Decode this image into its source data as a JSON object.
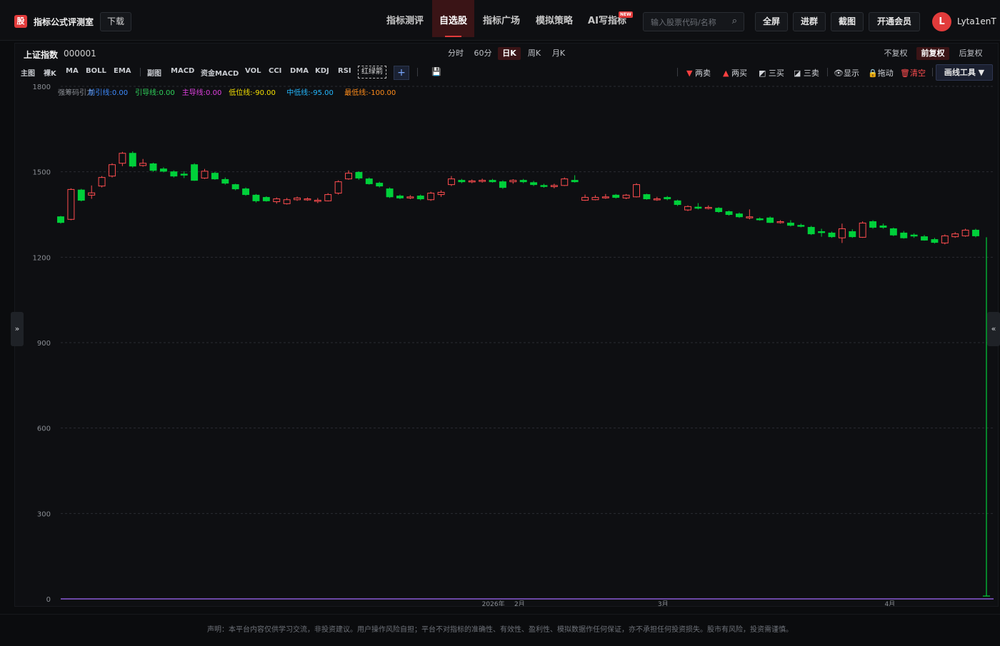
{
  "app": {
    "logo_text": "股",
    "brand": "指标公式评测室",
    "download": "下载",
    "nav": [
      "指标测评",
      "自选股",
      "指标广场",
      "模拟策略",
      "AI写指标"
    ],
    "nav_active": "自选股",
    "new_badge": "NEW",
    "search_placeholder": "输入股票代码/名称",
    "buttons": [
      "全屏",
      "进群",
      "截图",
      "开通会员"
    ],
    "avatar_initial": "L",
    "username": "Lyta1enT"
  },
  "instrument": {
    "name": "上证指数",
    "code": "000001"
  },
  "periods": [
    "分时",
    "60分",
    "日K",
    "周K",
    "月K"
  ],
  "period_active": "日K",
  "adjust": [
    "不复权",
    "前复权",
    "后复权"
  ],
  "adjust_active": "前复权",
  "indicators_main": [
    "主图",
    "裸K",
    "MA",
    "BOLL",
    "EMA"
  ],
  "indicators_sub": [
    "副图",
    "MACD",
    "资金MACD",
    "VOL",
    "CCI",
    "DMA",
    "KDJ",
    "RSI"
  ],
  "red_green_arrow": "红绿箭",
  "plus": "+",
  "tools": [
    {
      "icon": "▼",
      "label": "两卖",
      "color": "#ff4040"
    },
    {
      "icon": "▲",
      "label": "两买",
      "color": "#ff4040"
    },
    {
      "icon": "◩",
      "label": "三买",
      "color": "#d8d8d8"
    },
    {
      "icon": "◪",
      "label": "三卖",
      "color": "#d8d8d8"
    },
    {
      "icon": "👁",
      "label": "显示",
      "color": "#d8d8d8"
    },
    {
      "icon": "🔒",
      "label": "拖动",
      "color": "#f5c542"
    },
    {
      "icon": "🗑",
      "label": "清空",
      "color": "#ff4d4f"
    }
  ],
  "draw_tools": "画线工具 ▼",
  "legend": [
    {
      "text": "强筹码引力",
      "color": "#8a8e94"
    },
    {
      "text": "前引线:0.00",
      "color": "#3d8bff"
    },
    {
      "text": "引导线:0.00",
      "color": "#2fd15a"
    },
    {
      "text": "主导线:0.00",
      "color": "#e040e0"
    },
    {
      "text": "低位线:-90.00",
      "color": "#f5e000"
    },
    {
      "text": "中低线:-95.00",
      "color": "#23b8ff"
    },
    {
      "text": "最低线:-100.00",
      "color": "#ff8c1a"
    }
  ],
  "side_left": "»",
  "side_right": "«",
  "footer": "声明：本平台内容仅供学习交流，非投资建议。用户操作风险自担；平台不对指标的准确性、有效性、盈利性、模拟数据作任何保证，亦不承担任何投资损失。股市有风险，投资需谨慎。",
  "chart_data": {
    "type": "candlestick",
    "y_ticks": [
      1800,
      1500,
      1200,
      900,
      600,
      300,
      0
    ],
    "ylim": [
      0,
      1800
    ],
    "grid": true,
    "x_labels": [
      "2026年",
      "2月",
      "3月",
      "4月"
    ],
    "up_color": "#ff4d4f",
    "down_color": "#00d03a",
    "candles": [
      {
        "o": 1342,
        "c": 1322,
        "h": 1345,
        "l": 1318
      },
      {
        "o": 1333,
        "c": 1438,
        "h": 1442,
        "l": 1330
      },
      {
        "o": 1436,
        "c": 1400,
        "h": 1440,
        "l": 1396
      },
      {
        "o": 1418,
        "c": 1426,
        "h": 1452,
        "l": 1405
      },
      {
        "o": 1450,
        "c": 1480,
        "h": 1485,
        "l": 1445
      },
      {
        "o": 1485,
        "c": 1525,
        "h": 1530,
        "l": 1480
      },
      {
        "o": 1530,
        "c": 1565,
        "h": 1570,
        "l": 1520
      },
      {
        "o": 1565,
        "c": 1520,
        "h": 1572,
        "l": 1515
      },
      {
        "o": 1522,
        "c": 1530,
        "h": 1545,
        "l": 1518
      },
      {
        "o": 1528,
        "c": 1505,
        "h": 1532,
        "l": 1500
      },
      {
        "o": 1510,
        "c": 1502,
        "h": 1516,
        "l": 1498
      },
      {
        "o": 1500,
        "c": 1485,
        "h": 1505,
        "l": 1480
      },
      {
        "o": 1492,
        "c": 1490,
        "h": 1502,
        "l": 1478
      },
      {
        "o": 1525,
        "c": 1470,
        "h": 1530,
        "l": 1468
      },
      {
        "o": 1478,
        "c": 1502,
        "h": 1510,
        "l": 1475
      },
      {
        "o": 1495,
        "c": 1475,
        "h": 1500,
        "l": 1472
      },
      {
        "o": 1473,
        "c": 1460,
        "h": 1480,
        "l": 1455
      },
      {
        "o": 1455,
        "c": 1440,
        "h": 1458,
        "l": 1435
      },
      {
        "o": 1440,
        "c": 1420,
        "h": 1445,
        "l": 1416
      },
      {
        "o": 1418,
        "c": 1398,
        "h": 1422,
        "l": 1392
      },
      {
        "o": 1410,
        "c": 1398,
        "h": 1414,
        "l": 1395
      },
      {
        "o": 1395,
        "c": 1405,
        "h": 1410,
        "l": 1388
      },
      {
        "o": 1388,
        "c": 1402,
        "h": 1408,
        "l": 1385
      },
      {
        "o": 1402,
        "c": 1408,
        "h": 1413,
        "l": 1398
      },
      {
        "o": 1402,
        "c": 1405,
        "h": 1410,
        "l": 1398
      },
      {
        "o": 1398,
        "c": 1400,
        "h": 1408,
        "l": 1390
      },
      {
        "o": 1398,
        "c": 1420,
        "h": 1425,
        "l": 1396
      },
      {
        "o": 1425,
        "c": 1465,
        "h": 1470,
        "l": 1420
      },
      {
        "o": 1475,
        "c": 1495,
        "h": 1505,
        "l": 1472
      },
      {
        "o": 1498,
        "c": 1478,
        "h": 1502,
        "l": 1472
      },
      {
        "o": 1475,
        "c": 1458,
        "h": 1480,
        "l": 1455
      },
      {
        "o": 1460,
        "c": 1450,
        "h": 1465,
        "l": 1445
      },
      {
        "o": 1440,
        "c": 1412,
        "h": 1445,
        "l": 1408
      },
      {
        "o": 1415,
        "c": 1408,
        "h": 1420,
        "l": 1404
      },
      {
        "o": 1408,
        "c": 1412,
        "h": 1418,
        "l": 1404
      },
      {
        "o": 1415,
        "c": 1405,
        "h": 1420,
        "l": 1400
      },
      {
        "o": 1402,
        "c": 1425,
        "h": 1430,
        "l": 1398
      },
      {
        "o": 1420,
        "c": 1428,
        "h": 1435,
        "l": 1412
      },
      {
        "o": 1455,
        "c": 1475,
        "h": 1485,
        "l": 1450
      },
      {
        "o": 1470,
        "c": 1465,
        "h": 1475,
        "l": 1460
      },
      {
        "o": 1465,
        "c": 1468,
        "h": 1473,
        "l": 1460
      },
      {
        "o": 1468,
        "c": 1470,
        "h": 1476,
        "l": 1462
      },
      {
        "o": 1470,
        "c": 1465,
        "h": 1475,
        "l": 1462
      },
      {
        "o": 1465,
        "c": 1445,
        "h": 1470,
        "l": 1440
      },
      {
        "o": 1465,
        "c": 1470,
        "h": 1474,
        "l": 1458
      },
      {
        "o": 1470,
        "c": 1465,
        "h": 1475,
        "l": 1460
      },
      {
        "o": 1462,
        "c": 1455,
        "h": 1468,
        "l": 1450
      },
      {
        "o": 1452,
        "c": 1450,
        "h": 1458,
        "l": 1444
      },
      {
        "o": 1448,
        "c": 1452,
        "h": 1458,
        "l": 1442
      },
      {
        "o": 1452,
        "c": 1475,
        "h": 1480,
        "l": 1450
      },
      {
        "o": 1470,
        "c": 1465,
        "h": 1488,
        "l": 1462
      },
      {
        "o": 1400,
        "c": 1410,
        "h": 1420,
        "l": 1398
      },
      {
        "o": 1402,
        "c": 1410,
        "h": 1418,
        "l": 1400
      },
      {
        "o": 1410,
        "c": 1412,
        "h": 1422,
        "l": 1405
      },
      {
        "o": 1418,
        "c": 1410,
        "h": 1422,
        "l": 1406
      },
      {
        "o": 1408,
        "c": 1418,
        "h": 1422,
        "l": 1404
      },
      {
        "o": 1412,
        "c": 1455,
        "h": 1460,
        "l": 1410
      },
      {
        "o": 1420,
        "c": 1405,
        "h": 1423,
        "l": 1402
      },
      {
        "o": 1405,
        "c": 1405,
        "h": 1412,
        "l": 1398
      },
      {
        "o": 1410,
        "c": 1405,
        "h": 1415,
        "l": 1400
      },
      {
        "o": 1398,
        "c": 1385,
        "h": 1402,
        "l": 1380
      },
      {
        "o": 1366,
        "c": 1378,
        "h": 1382,
        "l": 1362
      },
      {
        "o": 1376,
        "c": 1372,
        "h": 1390,
        "l": 1368
      },
      {
        "o": 1372,
        "c": 1375,
        "h": 1382,
        "l": 1368
      },
      {
        "o": 1372,
        "c": 1360,
        "h": 1376,
        "l": 1356
      },
      {
        "o": 1360,
        "c": 1350,
        "h": 1364,
        "l": 1346
      },
      {
        "o": 1352,
        "c": 1342,
        "h": 1357,
        "l": 1338
      },
      {
        "o": 1338,
        "c": 1342,
        "h": 1368,
        "l": 1333
      },
      {
        "o": 1335,
        "c": 1332,
        "h": 1340,
        "l": 1328
      },
      {
        "o": 1338,
        "c": 1322,
        "h": 1343,
        "l": 1320
      },
      {
        "o": 1322,
        "c": 1325,
        "h": 1330,
        "l": 1318
      },
      {
        "o": 1320,
        "c": 1312,
        "h": 1330,
        "l": 1308
      },
      {
        "o": 1312,
        "c": 1310,
        "h": 1318,
        "l": 1305
      },
      {
        "o": 1305,
        "c": 1282,
        "h": 1310,
        "l": 1278
      },
      {
        "o": 1290,
        "c": 1288,
        "h": 1300,
        "l": 1272
      },
      {
        "o": 1285,
        "c": 1272,
        "h": 1290,
        "l": 1268
      },
      {
        "o": 1268,
        "c": 1300,
        "h": 1318,
        "l": 1250
      },
      {
        "o": 1290,
        "c": 1272,
        "h": 1298,
        "l": 1268
      },
      {
        "o": 1270,
        "c": 1320,
        "h": 1326,
        "l": 1268
      },
      {
        "o": 1325,
        "c": 1305,
        "h": 1330,
        "l": 1300
      },
      {
        "o": 1310,
        "c": 1305,
        "h": 1318,
        "l": 1300
      },
      {
        "o": 1300,
        "c": 1278,
        "h": 1304,
        "l": 1274
      },
      {
        "o": 1285,
        "c": 1268,
        "h": 1292,
        "l": 1265
      },
      {
        "o": 1278,
        "c": 1275,
        "h": 1284,
        "l": 1268
      },
      {
        "o": 1272,
        "c": 1260,
        "h": 1278,
        "l": 1258
      },
      {
        "o": 1262,
        "c": 1252,
        "h": 1268,
        "l": 1248
      },
      {
        "o": 1250,
        "c": 1275,
        "h": 1280,
        "l": 1245
      },
      {
        "o": 1272,
        "c": 1282,
        "h": 1288,
        "l": 1268
      },
      {
        "o": 1275,
        "c": 1295,
        "h": 1300,
        "l": 1272
      },
      {
        "o": 1295,
        "c": 1275,
        "h": 1300,
        "l": 1270
      }
    ],
    "last_line": {
      "top": 1270,
      "bottom": 10
    }
  }
}
